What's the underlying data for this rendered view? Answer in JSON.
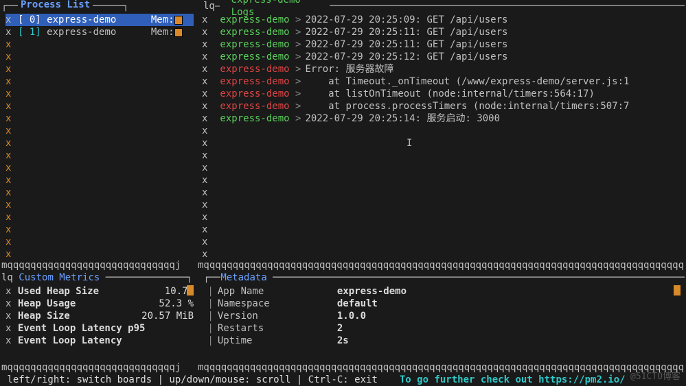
{
  "panels": {
    "processList": {
      "title": "Process List"
    },
    "logs": {
      "title": "express-demo Logs",
      "prefix": "lq—"
    },
    "metrics": {
      "title": "Custom Metrics",
      "prefix": "lq"
    },
    "metadata": {
      "title": "Metadata"
    }
  },
  "processes": [
    {
      "index": "[ 0]",
      "name": "express-demo",
      "memLabel": "Mem:",
      "selected": true
    },
    {
      "index": "[ 1]",
      "name": "express-demo",
      "memLabel": "Mem:",
      "selected": false
    }
  ],
  "logs": [
    {
      "name": "express-demo",
      "state": "ok",
      "sep": "|",
      "msg": "2022-07-29 20:25:09: GET /api/users"
    },
    {
      "name": "express-demo",
      "state": "ok",
      "sep": "|",
      "msg": "2022-07-29 20:25:11: GET /api/users"
    },
    {
      "name": "express-demo",
      "state": "ok",
      "sep": "|",
      "msg": "2022-07-29 20:25:11: GET /api/users"
    },
    {
      "name": "express-demo",
      "state": "ok",
      "sep": "|",
      "msg": "2022-07-29 20:25:12: GET /api/users"
    },
    {
      "name": "express-demo",
      "state": "err",
      "sep": ">",
      "msg": "Error: 服务器故障"
    },
    {
      "name": "express-demo",
      "state": "err",
      "sep": ">",
      "msg": "    at Timeout._onTimeout (/www/express-demo/server.js:1"
    },
    {
      "name": "express-demo",
      "state": "err",
      "sep": ">",
      "msg": "    at listOnTimeout (node:internal/timers:564:17)"
    },
    {
      "name": "express-demo",
      "state": "err",
      "sep": ">",
      "msg": "    at process.processTimers (node:internal/timers:507:7"
    },
    {
      "name": "express-demo",
      "state": "ok",
      "sep": "|",
      "msg": "2022-07-29 20:25:14: 服务启动: 3000"
    }
  ],
  "logEmptyRows": 12,
  "procEmptyRows": 18,
  "metrics": [
    {
      "label": "Used Heap Size",
      "value": "10.76"
    },
    {
      "label": "Heap Usage",
      "value": "52.3 %"
    },
    {
      "label": "Heap Size",
      "value": "20.57 MiB"
    },
    {
      "label": "Event Loop Latency p95",
      "value": ""
    },
    {
      "label": "Event Loop Latency",
      "value": ""
    }
  ],
  "metadata": [
    {
      "label": "App Name",
      "value": "express-demo"
    },
    {
      "label": "Namespace",
      "value": "default"
    },
    {
      "label": "Version",
      "value": "1.0.0"
    },
    {
      "label": "Restarts",
      "value": "2"
    },
    {
      "label": "Uptime",
      "value": "2s"
    }
  ],
  "divider_q_left": "mqqqqqqqqqqqqqqqqqqqqqqqqqqqqqj",
  "divider_q_right": "mqqqqqqqqqqqqqqqqqqqqqqqqqqqqqqqqqqqqqqqqqqqqqqqqqqqqqqqqqqqqqqqqqqqqqqqqqqqqqqqqqqqqqqqqqj",
  "footer": {
    "hints": " left/right: switch boards | up/down/mouse: scroll | Ctrl-C: exit",
    "link": "To go further check out https://pm2.io/"
  },
  "watermark": "@51CTO博客",
  "gt": ">",
  "pipe": "|",
  "cursor": "I"
}
